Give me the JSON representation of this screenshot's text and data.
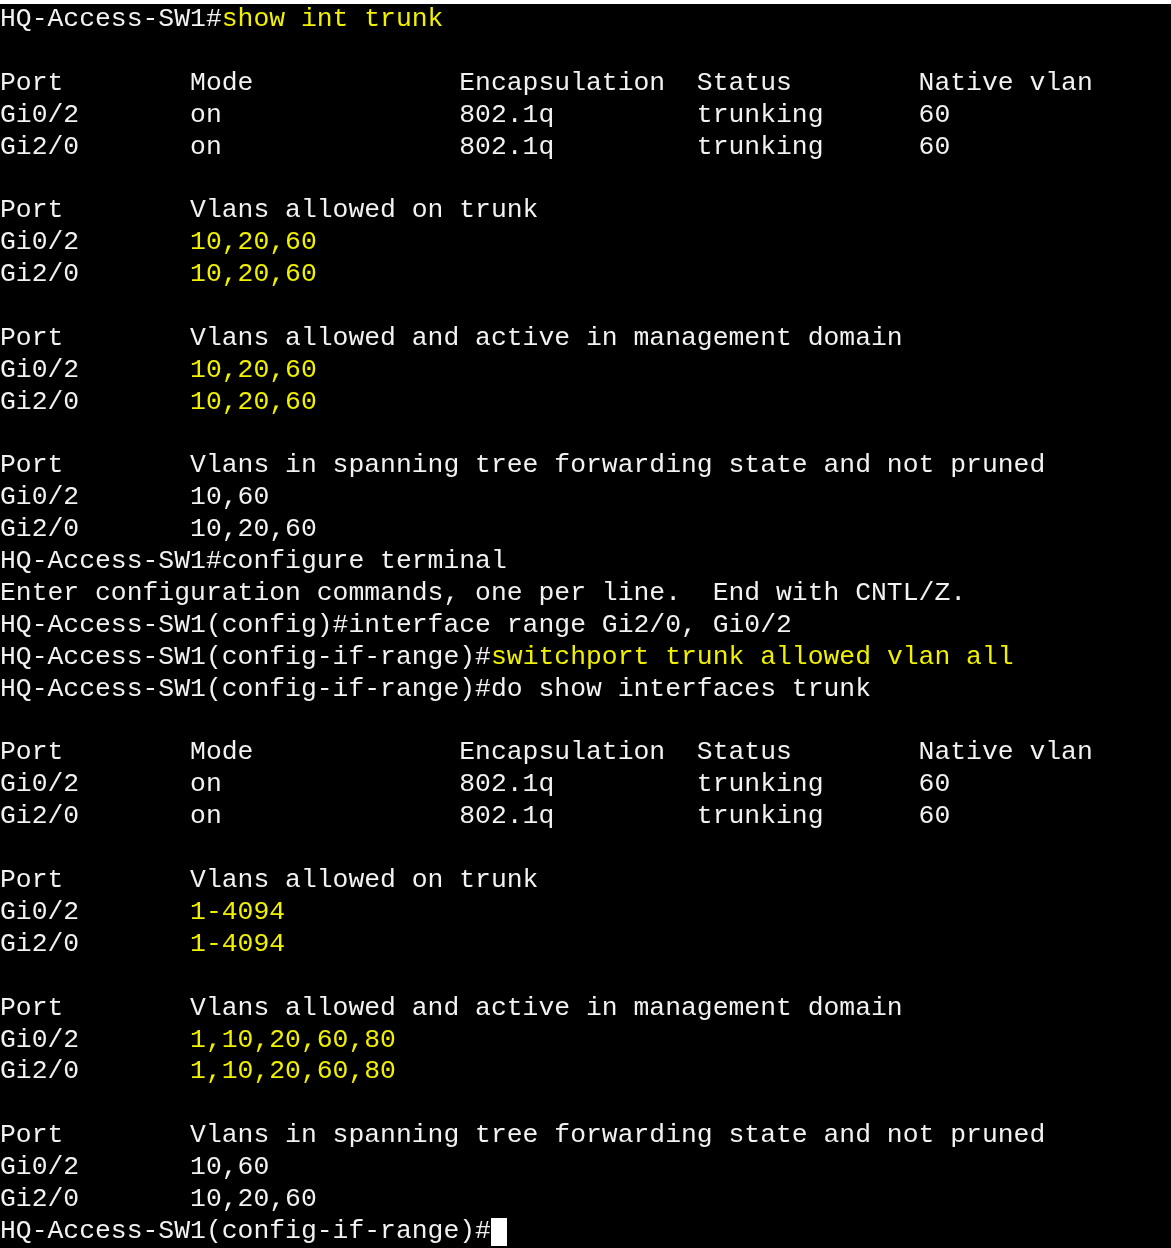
{
  "terminal": {
    "blocks": [
      {
        "lines": [
          {
            "segments": [
              {
                "text": "HQ-Access-SW1#",
                "highlight": false
              },
              {
                "text": "show int trunk",
                "highlight": true
              }
            ]
          }
        ]
      },
      {
        "lines": [
          {
            "segments": [
              {
                "text": "Port        Mode             Encapsulation  Status        Native vlan",
                "highlight": false
              }
            ]
          },
          {
            "segments": [
              {
                "text": "Gi0/2       on               802.1q         trunking      60",
                "highlight": false
              }
            ]
          },
          {
            "segments": [
              {
                "text": "Gi2/0       on               802.1q         trunking      60",
                "highlight": false
              }
            ]
          }
        ]
      },
      {
        "lines": [
          {
            "segments": [
              {
                "text": "Port        Vlans allowed on trunk",
                "highlight": false
              }
            ]
          },
          {
            "segments": [
              {
                "text": "Gi0/2       ",
                "highlight": false
              },
              {
                "text": "10,20,60",
                "highlight": true
              }
            ]
          },
          {
            "segments": [
              {
                "text": "Gi2/0       ",
                "highlight": false
              },
              {
                "text": "10,20,60",
                "highlight": true
              }
            ]
          }
        ]
      },
      {
        "lines": [
          {
            "segments": [
              {
                "text": "Port        Vlans allowed and active in management domain",
                "highlight": false
              }
            ]
          },
          {
            "segments": [
              {
                "text": "Gi0/2       ",
                "highlight": false
              },
              {
                "text": "10,20,60",
                "highlight": true
              }
            ]
          },
          {
            "segments": [
              {
                "text": "Gi2/0       ",
                "highlight": false
              },
              {
                "text": "10,20,60",
                "highlight": true
              }
            ]
          }
        ]
      },
      {
        "lines": [
          {
            "segments": [
              {
                "text": "Port        Vlans in spanning tree forwarding state and not pruned",
                "highlight": false
              }
            ]
          },
          {
            "segments": [
              {
                "text": "Gi0/2       10,60",
                "highlight": false
              }
            ]
          },
          {
            "segments": [
              {
                "text": "Gi2/0       10,20,60",
                "highlight": false
              }
            ]
          },
          {
            "segments": [
              {
                "text": "HQ-Access-SW1#configure terminal",
                "highlight": false
              }
            ]
          },
          {
            "segments": [
              {
                "text": "Enter configuration commands, one per line.  End with CNTL/Z.",
                "highlight": false
              }
            ]
          },
          {
            "segments": [
              {
                "text": "HQ-Access-SW1(config)#interface range Gi2/0, Gi0/2",
                "highlight": false
              }
            ]
          },
          {
            "segments": [
              {
                "text": "HQ-Access-SW1(config-if-range)#",
                "highlight": false
              },
              {
                "text": "switchport trunk allowed vlan all",
                "highlight": true
              }
            ]
          },
          {
            "segments": [
              {
                "text": "HQ-Access-SW1(config-if-range)#do show interfaces trunk",
                "highlight": false
              }
            ]
          }
        ]
      },
      {
        "lines": [
          {
            "segments": [
              {
                "text": "Port        Mode             Encapsulation  Status        Native vlan",
                "highlight": false
              }
            ]
          },
          {
            "segments": [
              {
                "text": "Gi0/2       on               802.1q         trunking      60",
                "highlight": false
              }
            ]
          },
          {
            "segments": [
              {
                "text": "Gi2/0       on               802.1q         trunking      60",
                "highlight": false
              }
            ]
          }
        ]
      },
      {
        "lines": [
          {
            "segments": [
              {
                "text": "Port        Vlans allowed on trunk",
                "highlight": false
              }
            ]
          },
          {
            "segments": [
              {
                "text": "Gi0/2       ",
                "highlight": false
              },
              {
                "text": "1-4094",
                "highlight": true
              }
            ]
          },
          {
            "segments": [
              {
                "text": "Gi2/0       ",
                "highlight": false
              },
              {
                "text": "1-4094",
                "highlight": true
              }
            ]
          }
        ]
      },
      {
        "lines": [
          {
            "segments": [
              {
                "text": "Port        Vlans allowed and active in management domain",
                "highlight": false
              }
            ]
          },
          {
            "segments": [
              {
                "text": "Gi0/2       ",
                "highlight": false
              },
              {
                "text": "1,10,20,60,80",
                "highlight": true
              }
            ]
          },
          {
            "segments": [
              {
                "text": "Gi2/0       ",
                "highlight": false
              },
              {
                "text": "1,10,20,60,80",
                "highlight": true
              }
            ]
          }
        ]
      },
      {
        "lines": [
          {
            "segments": [
              {
                "text": "Port        Vlans in spanning tree forwarding state and not pruned",
                "highlight": false
              }
            ]
          },
          {
            "segments": [
              {
                "text": "Gi0/2       10,60",
                "highlight": false
              }
            ]
          },
          {
            "segments": [
              {
                "text": "Gi2/0       10,20,60",
                "highlight": false
              }
            ]
          },
          {
            "segments": [
              {
                "text": "HQ-Access-SW1(config-if-range)#",
                "highlight": false
              }
            ]
          }
        ]
      }
    ]
  }
}
